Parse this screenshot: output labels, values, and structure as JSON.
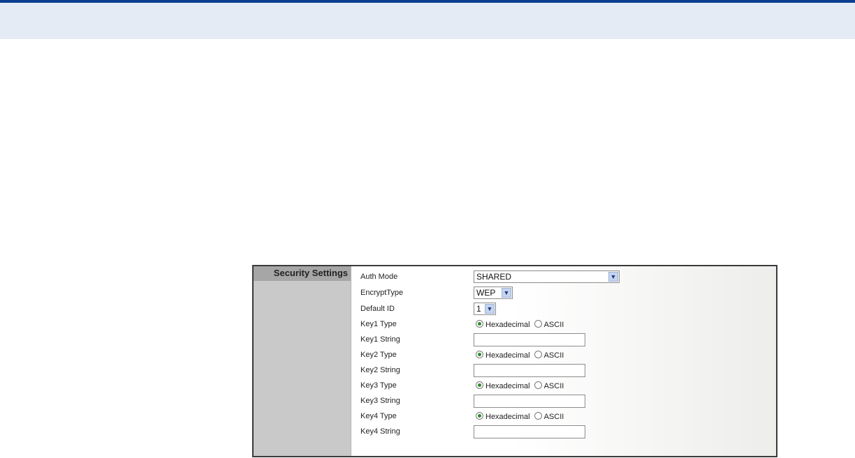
{
  "panel": {
    "title": "Security Settings"
  },
  "fields": {
    "auth_mode": {
      "label": "Auth Mode",
      "value": "SHARED"
    },
    "encrypt_type": {
      "label": "EncryptType",
      "value": "WEP"
    },
    "default_id": {
      "label": "Default ID",
      "value": "1"
    },
    "key1_type": {
      "label": "Key1 Type",
      "options": [
        "Hexadecimal",
        "ASCII"
      ],
      "selected": "Hexadecimal"
    },
    "key1_string": {
      "label": "Key1 String",
      "value": ""
    },
    "key2_type": {
      "label": "Key2 Type",
      "options": [
        "Hexadecimal",
        "ASCII"
      ],
      "selected": "Hexadecimal"
    },
    "key2_string": {
      "label": "Key2 String",
      "value": ""
    },
    "key3_type": {
      "label": "Key3 Type",
      "options": [
        "Hexadecimal",
        "ASCII"
      ],
      "selected": "Hexadecimal"
    },
    "key3_string": {
      "label": "Key3 String",
      "value": ""
    },
    "key4_type": {
      "label": "Key4 Type",
      "options": [
        "Hexadecimal",
        "ASCII"
      ],
      "selected": "Hexadecimal"
    },
    "key4_string": {
      "label": "Key4 String",
      "value": ""
    }
  },
  "icons": {
    "dropdown": "chevron-down-icon"
  },
  "colors": {
    "top_bar": "#e4ebf4",
    "top_rule": "#0a3f8f",
    "radio_selected": "#2e8b2e"
  }
}
